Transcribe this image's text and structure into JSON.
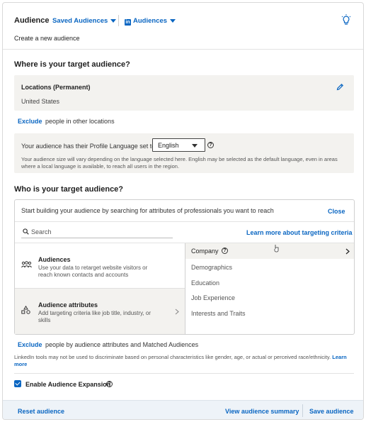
{
  "header": {
    "title": "Audience",
    "saved_audiences": "Saved Audiences",
    "audiences": "Audiences",
    "subtitle": "Create a new audience"
  },
  "where": {
    "heading": "Where is your target audience?",
    "locations_label": "Locations (Permanent)",
    "locations_value": "United States",
    "exclude": "Exclude",
    "exclude_note": "people in other locations",
    "language_prompt": "Your audience has their Profile Language set to",
    "language_value": "English",
    "language_note": "Your audience size will vary depending on the language selected here. English may be selected as the default language, even in areas where a local language is available, to reach all users in the region."
  },
  "who": {
    "heading": "Who is your target audience?",
    "prompt": "Start building your audience by searching for attributes of professionals you want to reach",
    "close": "Close",
    "search_placeholder": "Search",
    "learn_more": "Learn more about targeting criteria",
    "left_items": [
      {
        "title": "Audiences",
        "desc": "Use your data to retarget website visitors or reach known contacts and accounts"
      },
      {
        "title": "Audience attributes",
        "desc": "Add targeting criteria like job title, industry, or skills"
      }
    ],
    "right_items": [
      "Company",
      "Demographics",
      "Education",
      "Job Experience",
      "Interests and Traits"
    ],
    "exclude": "Exclude",
    "exclude_note": "people by audience attributes and Matched Audiences",
    "disclaimer": "LinkedIn tools may not be used to discriminate based on personal characteristics like gender, age, or actual or perceived race/ethnicity.",
    "disclaimer_link": "Learn more",
    "expansion_label": "Enable Audience Expansion",
    "expansion_checked": true
  },
  "footer": {
    "reset": "Reset audience",
    "view_summary": "View audience summary",
    "save": "Save audience"
  },
  "colors": {
    "accent": "#0a66c2",
    "panel": "#f3f2ef",
    "footer": "#eef3f8"
  }
}
